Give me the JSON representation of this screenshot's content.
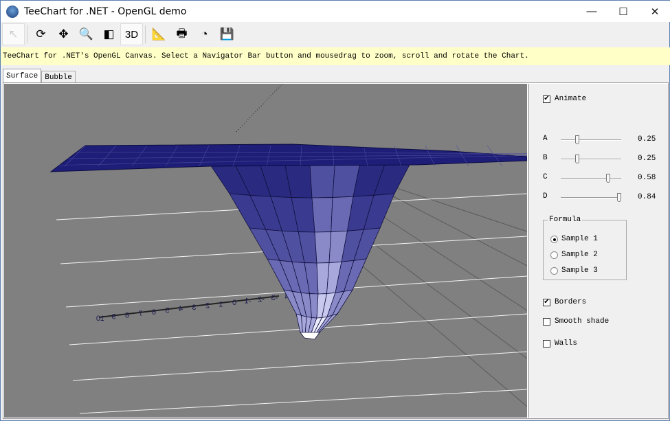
{
  "window": {
    "title": "TeeChart for .NET - OpenGL demo",
    "minimize": "—",
    "maximize": "☐",
    "close": "✕"
  },
  "toolbar": [
    {
      "name": "pointer-tool-button",
      "icon": "↖",
      "pressed": true
    },
    {
      "name": "rotate-tool-button",
      "icon": "⟳"
    },
    {
      "name": "move-tool-button",
      "icon": "✥"
    },
    {
      "name": "zoom-tool-button",
      "icon": "🔍"
    },
    {
      "name": "depth-tool-button",
      "icon": "◧"
    },
    {
      "name": "toggle-3d-button",
      "icon": "3D",
      "pressed": true
    },
    {
      "name": "edit-chart-button",
      "icon": "📐"
    },
    {
      "name": "print-button",
      "icon": "🖶"
    },
    {
      "name": "export-button",
      "icon": "◔"
    },
    {
      "name": "save-button",
      "icon": "💾"
    }
  ],
  "hint": "TeeChart for .NET's OpenGL Canvas. Select a Navigator Bar button and mousedrag to zoom, scroll and rotate the Chart.",
  "tabs": [
    {
      "label": "Surface",
      "active": true
    },
    {
      "label": "Bubble"
    }
  ],
  "chart": {
    "axis_ticks": [
      "10",
      "9",
      "8",
      "7",
      "6",
      "5",
      "4",
      "3",
      "2",
      "1",
      "0",
      "-1",
      "-2",
      "-3",
      "-4"
    ],
    "surface_color": "#1e1e78",
    "background": "#808080"
  },
  "panel": {
    "animate": {
      "label": "Animate",
      "checked": true
    },
    "sliders": [
      {
        "label": "A",
        "value": "0.25",
        "fraction": 0.25
      },
      {
        "label": "B",
        "value": "0.25",
        "fraction": 0.25
      },
      {
        "label": "C",
        "value": "0.58",
        "fraction": 0.78
      },
      {
        "label": "D",
        "value": "0.84",
        "fraction": 0.98
      }
    ],
    "formula": {
      "label": "Formula",
      "options": [
        {
          "label": "Sample 1",
          "selected": true
        },
        {
          "label": "Sample 2"
        },
        {
          "label": "Sample 3"
        }
      ]
    },
    "borders": {
      "label": "Borders",
      "checked": true
    },
    "smooth": {
      "label": "Smooth shade",
      "checked": false
    },
    "walls": {
      "label": "Walls",
      "checked": false
    }
  }
}
